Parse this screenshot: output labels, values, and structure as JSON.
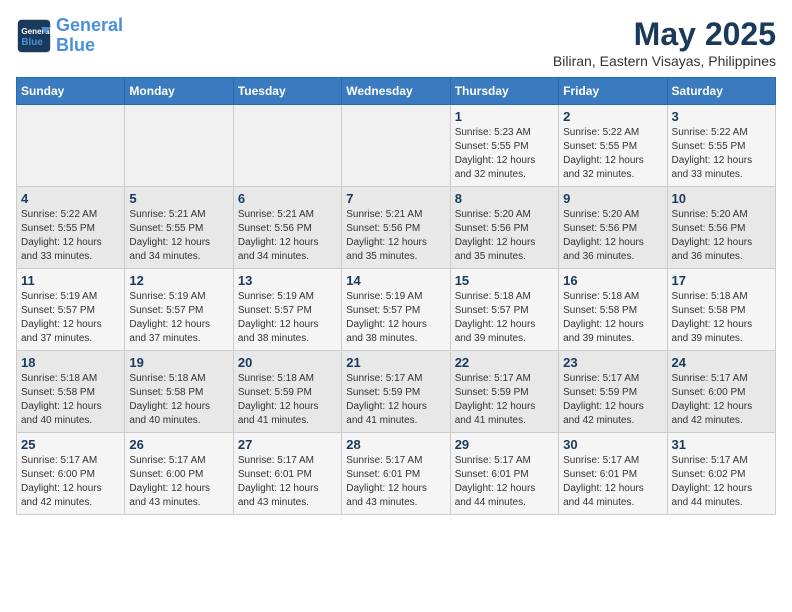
{
  "header": {
    "logo_line1": "General",
    "logo_line2": "Blue",
    "month": "May 2025",
    "location": "Biliran, Eastern Visayas, Philippines"
  },
  "weekdays": [
    "Sunday",
    "Monday",
    "Tuesday",
    "Wednesday",
    "Thursday",
    "Friday",
    "Saturday"
  ],
  "weeks": [
    [
      {
        "day": "",
        "info": ""
      },
      {
        "day": "",
        "info": ""
      },
      {
        "day": "",
        "info": ""
      },
      {
        "day": "",
        "info": ""
      },
      {
        "day": "1",
        "info": "Sunrise: 5:23 AM\nSunset: 5:55 PM\nDaylight: 12 hours\nand 32 minutes."
      },
      {
        "day": "2",
        "info": "Sunrise: 5:22 AM\nSunset: 5:55 PM\nDaylight: 12 hours\nand 32 minutes."
      },
      {
        "day": "3",
        "info": "Sunrise: 5:22 AM\nSunset: 5:55 PM\nDaylight: 12 hours\nand 33 minutes."
      }
    ],
    [
      {
        "day": "4",
        "info": "Sunrise: 5:22 AM\nSunset: 5:55 PM\nDaylight: 12 hours\nand 33 minutes."
      },
      {
        "day": "5",
        "info": "Sunrise: 5:21 AM\nSunset: 5:55 PM\nDaylight: 12 hours\nand 34 minutes."
      },
      {
        "day": "6",
        "info": "Sunrise: 5:21 AM\nSunset: 5:56 PM\nDaylight: 12 hours\nand 34 minutes."
      },
      {
        "day": "7",
        "info": "Sunrise: 5:21 AM\nSunset: 5:56 PM\nDaylight: 12 hours\nand 35 minutes."
      },
      {
        "day": "8",
        "info": "Sunrise: 5:20 AM\nSunset: 5:56 PM\nDaylight: 12 hours\nand 35 minutes."
      },
      {
        "day": "9",
        "info": "Sunrise: 5:20 AM\nSunset: 5:56 PM\nDaylight: 12 hours\nand 36 minutes."
      },
      {
        "day": "10",
        "info": "Sunrise: 5:20 AM\nSunset: 5:56 PM\nDaylight: 12 hours\nand 36 minutes."
      }
    ],
    [
      {
        "day": "11",
        "info": "Sunrise: 5:19 AM\nSunset: 5:57 PM\nDaylight: 12 hours\nand 37 minutes."
      },
      {
        "day": "12",
        "info": "Sunrise: 5:19 AM\nSunset: 5:57 PM\nDaylight: 12 hours\nand 37 minutes."
      },
      {
        "day": "13",
        "info": "Sunrise: 5:19 AM\nSunset: 5:57 PM\nDaylight: 12 hours\nand 38 minutes."
      },
      {
        "day": "14",
        "info": "Sunrise: 5:19 AM\nSunset: 5:57 PM\nDaylight: 12 hours\nand 38 minutes."
      },
      {
        "day": "15",
        "info": "Sunrise: 5:18 AM\nSunset: 5:57 PM\nDaylight: 12 hours\nand 39 minutes."
      },
      {
        "day": "16",
        "info": "Sunrise: 5:18 AM\nSunset: 5:58 PM\nDaylight: 12 hours\nand 39 minutes."
      },
      {
        "day": "17",
        "info": "Sunrise: 5:18 AM\nSunset: 5:58 PM\nDaylight: 12 hours\nand 39 minutes."
      }
    ],
    [
      {
        "day": "18",
        "info": "Sunrise: 5:18 AM\nSunset: 5:58 PM\nDaylight: 12 hours\nand 40 minutes."
      },
      {
        "day": "19",
        "info": "Sunrise: 5:18 AM\nSunset: 5:58 PM\nDaylight: 12 hours\nand 40 minutes."
      },
      {
        "day": "20",
        "info": "Sunrise: 5:18 AM\nSunset: 5:59 PM\nDaylight: 12 hours\nand 41 minutes."
      },
      {
        "day": "21",
        "info": "Sunrise: 5:17 AM\nSunset: 5:59 PM\nDaylight: 12 hours\nand 41 minutes."
      },
      {
        "day": "22",
        "info": "Sunrise: 5:17 AM\nSunset: 5:59 PM\nDaylight: 12 hours\nand 41 minutes."
      },
      {
        "day": "23",
        "info": "Sunrise: 5:17 AM\nSunset: 5:59 PM\nDaylight: 12 hours\nand 42 minutes."
      },
      {
        "day": "24",
        "info": "Sunrise: 5:17 AM\nSunset: 6:00 PM\nDaylight: 12 hours\nand 42 minutes."
      }
    ],
    [
      {
        "day": "25",
        "info": "Sunrise: 5:17 AM\nSunset: 6:00 PM\nDaylight: 12 hours\nand 42 minutes."
      },
      {
        "day": "26",
        "info": "Sunrise: 5:17 AM\nSunset: 6:00 PM\nDaylight: 12 hours\nand 43 minutes."
      },
      {
        "day": "27",
        "info": "Sunrise: 5:17 AM\nSunset: 6:01 PM\nDaylight: 12 hours\nand 43 minutes."
      },
      {
        "day": "28",
        "info": "Sunrise: 5:17 AM\nSunset: 6:01 PM\nDaylight: 12 hours\nand 43 minutes."
      },
      {
        "day": "29",
        "info": "Sunrise: 5:17 AM\nSunset: 6:01 PM\nDaylight: 12 hours\nand 44 minutes."
      },
      {
        "day": "30",
        "info": "Sunrise: 5:17 AM\nSunset: 6:01 PM\nDaylight: 12 hours\nand 44 minutes."
      },
      {
        "day": "31",
        "info": "Sunrise: 5:17 AM\nSunset: 6:02 PM\nDaylight: 12 hours\nand 44 minutes."
      }
    ]
  ]
}
